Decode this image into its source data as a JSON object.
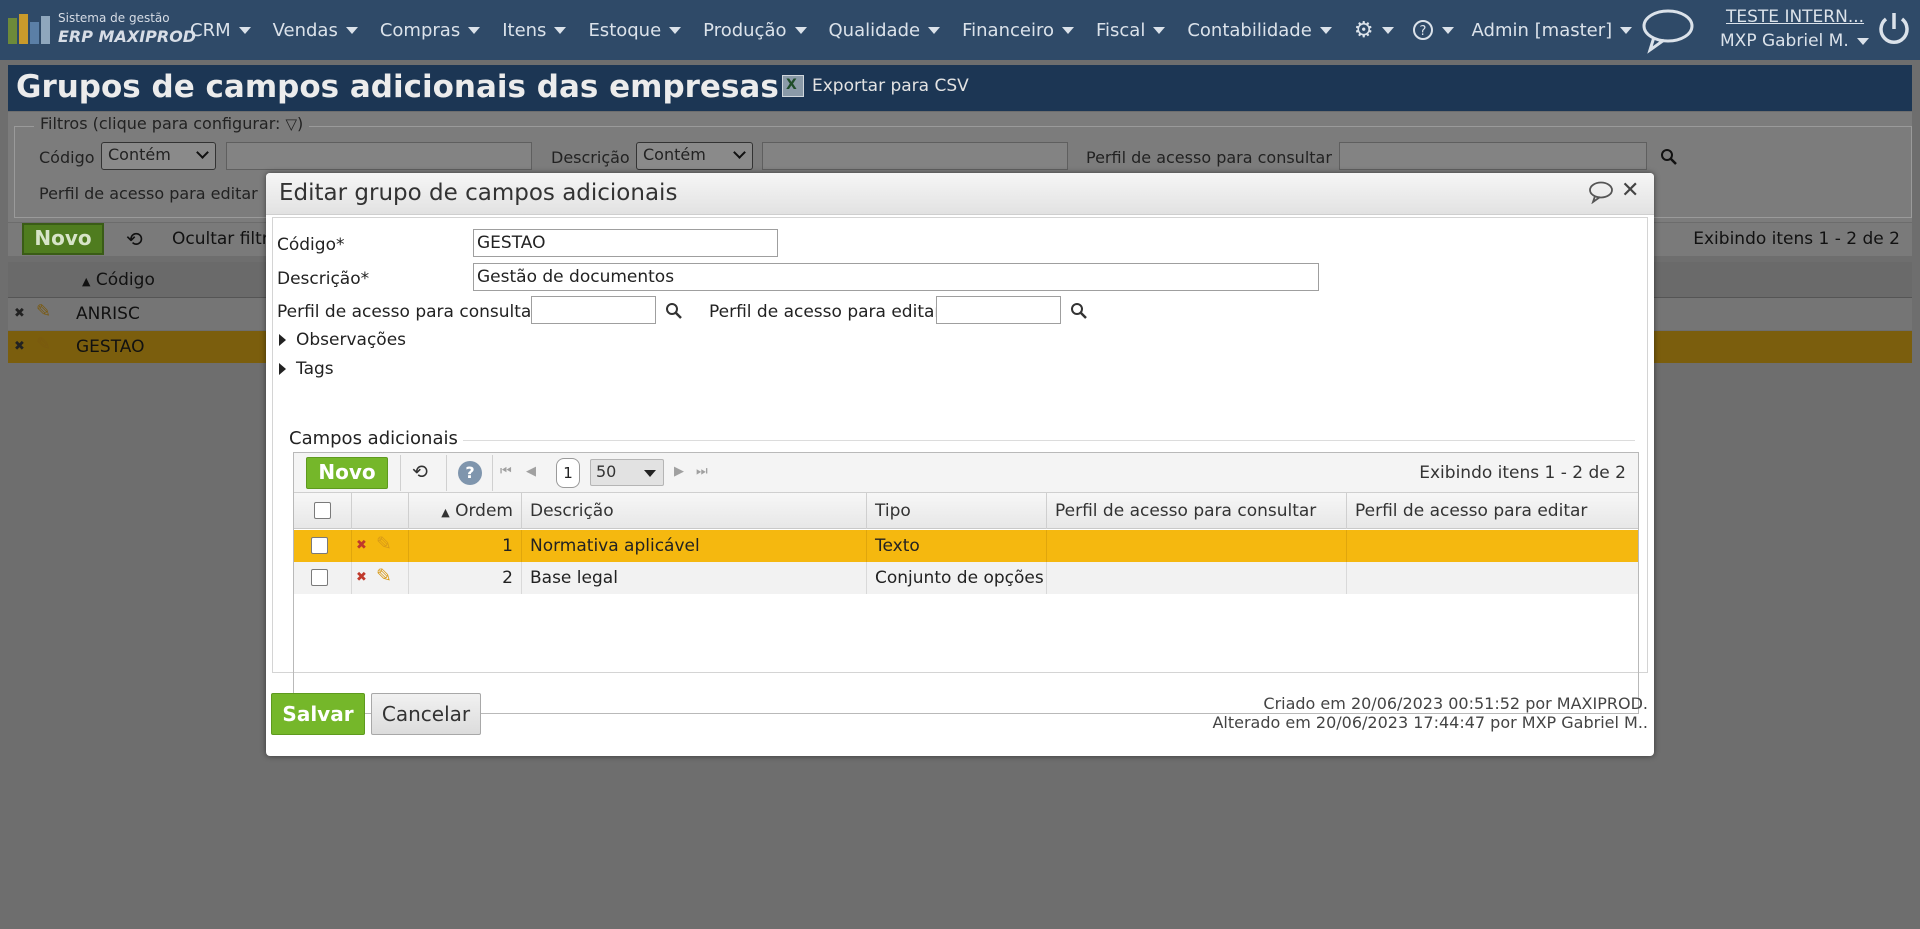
{
  "app": {
    "logo_line1": "Sistema de gestão",
    "logo_line2": "ERP MAXIPROD",
    "company": "TESTE INTERN...",
    "user": "MXP Gabriel M."
  },
  "nav": {
    "items": [
      {
        "label": "CRM"
      },
      {
        "label": "Vendas"
      },
      {
        "label": "Compras"
      },
      {
        "label": "Itens"
      },
      {
        "label": "Estoque"
      },
      {
        "label": "Produção"
      },
      {
        "label": "Qualidade"
      },
      {
        "label": "Financeiro"
      },
      {
        "label": "Fiscal"
      },
      {
        "label": "Contabilidade"
      }
    ],
    "admin": "Admin [master]"
  },
  "page": {
    "title": "Grupos de campos adicionais das empresas",
    "export_label": "Exportar para CSV"
  },
  "filters": {
    "legend": "Filtros (clique para configurar:",
    "legend_end": ")",
    "codigo_label": "Código",
    "codigo_op": "Contém",
    "descricao_label": "Descrição",
    "descricao_op": "Contém",
    "perfil_consultar_label": "Perfil de acesso para consultar",
    "perfil_editar_label": "Perfil de acesso para editar"
  },
  "list": {
    "novo_label": "Novo",
    "hide_filters": "Ocultar filtr",
    "count_text": "Exibindo itens 1 - 2 de 2",
    "column_codigo": "Código",
    "rows": [
      {
        "codigo": "ANRISC"
      },
      {
        "codigo": "GESTAO"
      }
    ]
  },
  "modal": {
    "title": "Editar grupo de campos adicionais",
    "codigo_label": "Código*",
    "codigo_value": "GESTAO",
    "descricao_label": "Descrição*",
    "descricao_value": "Gestão de documentos",
    "perfil_consultar_label": "Perfil de acesso para consultar",
    "perfil_editar_label": "Perfil de acesso para editar",
    "observacoes_label": "Observações",
    "tags_label": "Tags",
    "campos_legend": "Campos adicionais",
    "grid": {
      "novo_label": "Novo",
      "page_number": "1",
      "page_size": "50",
      "count_text": "Exibindo itens 1 - 2 de 2",
      "headers": {
        "ordem": "Ordem",
        "descricao": "Descrição",
        "tipo": "Tipo",
        "perfil_consultar": "Perfil de acesso para consultar",
        "perfil_editar": "Perfil de acesso para editar"
      },
      "rows": [
        {
          "ordem": "1",
          "descricao": "Normativa aplicável",
          "tipo": "Texto",
          "perfil_consultar": "",
          "perfil_editar": ""
        },
        {
          "ordem": "2",
          "descricao": "Base legal",
          "tipo": "Conjunto de opções",
          "perfil_consultar": "",
          "perfil_editar": ""
        }
      ]
    },
    "save_label": "Salvar",
    "cancel_label": "Cancelar",
    "created_text": "Criado em 20/06/2023 00:51:52 por MAXIPROD.",
    "altered_text": "Alterado em 20/06/2023 17:44:47 por MXP Gabriel M.."
  },
  "colors": {
    "topbar": "#2f4a68",
    "header": "#1c3654",
    "accent_green": "#75b72a",
    "selected_row": "#f5b80f"
  }
}
